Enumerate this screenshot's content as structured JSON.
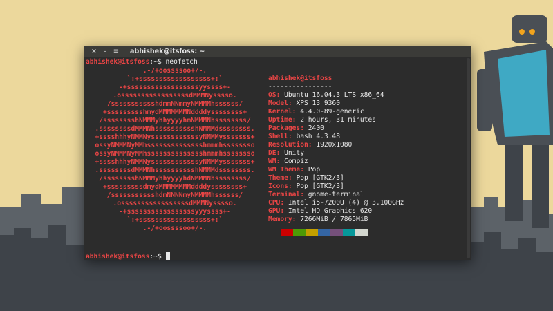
{
  "window": {
    "title": "abhishek@itsfoss: ~",
    "buttons": [
      "×",
      "–",
      "≡"
    ]
  },
  "prompt_user": "abhishek@itsfoss",
  "prompt_path": ":~$",
  "command": " neofetch",
  "logo_color": "#e84545",
  "logo_lines": [
    ".-/+oossssoo+/-.",
    "`:+ssssssssssssssssss+:`",
    "-+ssssssssssssssssssyyssss+-",
    ".osssssssssssssssssdMMMNysssso.",
    "/ssssssssssshdmmNNmmyNMMMMhssssss/",
    "+ssssssssshmydMMMMMMMNddddyssssssss+",
    "/sssssssshNMMMyhhyyyyhmNMMMNhssssssss/",
    ".ssssssssdMMMNhsssssssssshNMMMdssssssss.",
    "+sssshhhyNMMNyssssssssssssyNMMMysssssss+",
    "ossyNMMMNyMMhsssssssssssssshmmmhssssssso",
    "ossyNMMMNyMMhsssssssssssssshmmmhssssssso",
    "+sssshhhyNMMNyssssssssssssyNMMMysssssss+",
    ".ssssssssdMMMNhsssssssssshNMMMdssssssss.",
    "/sssssssshNMMMyhhyyyyhdNMMMNhssssssss/",
    "+sssssssssdmydMMMMMMMMddddyssssssss+",
    "/ssssssssssshdmNNNNmyNMMMMhssssss/",
    ".osssssssssssssssssdMMMNysssso.",
    "-+sssssssssssssssssyyyssss+-",
    "`:+ssssssssssssssssss+:`",
    ".-/+oossssoo+/-."
  ],
  "info": {
    "header": "abhishek@itsfoss",
    "separator": "----------------",
    "rows": [
      {
        "key": "OS",
        "value": "Ubuntu 16.04.3 LTS x86_64"
      },
      {
        "key": "Model",
        "value": "XPS 13 9360"
      },
      {
        "key": "Kernel",
        "value": "4.4.0-89-generic"
      },
      {
        "key": "Uptime",
        "value": "2 hours, 31 minutes"
      },
      {
        "key": "Packages",
        "value": "2400"
      },
      {
        "key": "Shell",
        "value": "bash 4.3.48"
      },
      {
        "key": "Resolution",
        "value": "1920x1080"
      },
      {
        "key": "DE",
        "value": "Unity"
      },
      {
        "key": "WM",
        "value": "Compiz"
      },
      {
        "key": "WM Theme",
        "value": "Pop"
      },
      {
        "key": "Theme",
        "value": "Pop [GTK2/3]"
      },
      {
        "key": "Icons",
        "value": "Pop [GTK2/3]"
      },
      {
        "key": "Terminal",
        "value": "gnome-terminal"
      },
      {
        "key": "CPU",
        "value": "Intel i5-7200U (4) @ 3.100GHz"
      },
      {
        "key": "GPU",
        "value": "Intel HD Graphics 620"
      },
      {
        "key": "Memory",
        "value": "7266MiB / 7865MiB"
      }
    ]
  },
  "palette": [
    "#2c2c2c",
    "#cc0000",
    "#4e9a06",
    "#c4a000",
    "#3465a4",
    "#75507b",
    "#06989a",
    "#d3d7cf"
  ],
  "wallpaper_colors": {
    "sky": "#ecd89c",
    "city_dark": "#3e4349",
    "city_light": "#5c6268",
    "robot_blue": "#3fa9c4",
    "robot_gray": "#4a4f55",
    "robot_eye": "#f2a41d"
  }
}
